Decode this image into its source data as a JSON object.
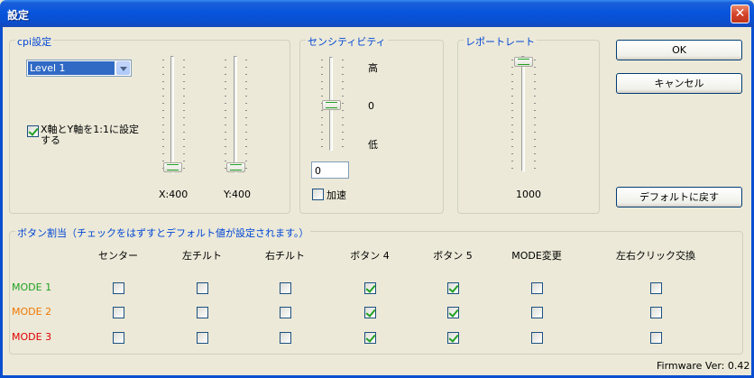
{
  "window": {
    "title": "設定",
    "close": "✕"
  },
  "cp_group": {
    "title": "cpi設定",
    "level_select": "Level 1",
    "link_checkbox_label": "X軸とY軸を1:1に設定する",
    "link_checked": true,
    "x_label": "X:400",
    "y_label": "Y:400",
    "x_level": 0,
    "y_level": 0
  },
  "sensitivity_group": {
    "title": "センシティビティ",
    "high": "高",
    "zero": "0",
    "low": "低",
    "value": "0",
    "accel_label": "加速",
    "accel_checked": false,
    "level": 0.5
  },
  "report_group": {
    "title": "レポートレート",
    "value_label": "1000",
    "level": 1
  },
  "buttons": {
    "ok": "OK",
    "cancel": "キャンセル",
    "default": "デフォルトに戻す"
  },
  "assign_group": {
    "title": "ボタン割当（チェックをはずすとデフォルト値が設定されます。）",
    "columns": [
      "センター",
      "左チルト",
      "右チルト",
      "ボタン 4",
      "ボタン 5",
      "MODE変更",
      "左右クリック交換"
    ],
    "rows": [
      {
        "label": "MODE 1",
        "checks": [
          false,
          false,
          false,
          true,
          true,
          false,
          false
        ]
      },
      {
        "label": "MODE 2",
        "checks": [
          false,
          false,
          false,
          true,
          true,
          false,
          false
        ]
      },
      {
        "label": "MODE 3",
        "checks": [
          false,
          false,
          false,
          true,
          true,
          false,
          false
        ]
      }
    ]
  },
  "firmware": "Firmware Ver: 0.42"
}
